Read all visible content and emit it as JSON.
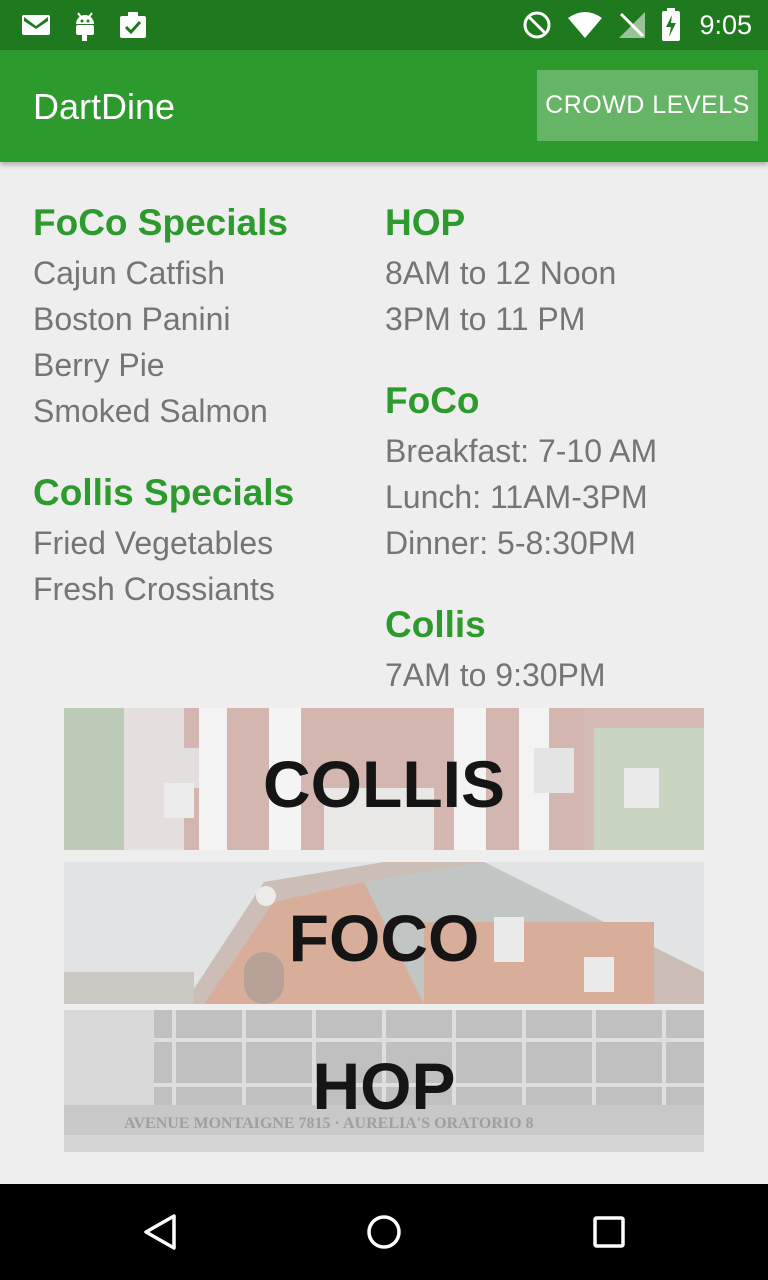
{
  "status_bar": {
    "time": "9:05",
    "left_icons": [
      "gmail-icon",
      "android-icon",
      "clipboard-check-icon"
    ],
    "right_icons": [
      "do-not-disturb-icon",
      "wifi-icon",
      "no-signal-icon",
      "battery-charging-icon"
    ]
  },
  "app_bar": {
    "title": "DartDine",
    "crowd_button": "CROWD LEVELS",
    "color": "#2c9a2c"
  },
  "specials": [
    {
      "title": "FoCo Specials",
      "items": [
        "Cajun Catfish",
        "Boston Panini",
        "Berry Pie",
        "Smoked Salmon"
      ]
    },
    {
      "title": "Collis Specials",
      "items": [
        "Fried Vegetables",
        "Fresh Crossiants"
      ]
    }
  ],
  "hours": [
    {
      "title": "HOP",
      "lines": [
        "8AM to 12 Noon",
        "3PM to 11 PM"
      ]
    },
    {
      "title": "FoCo",
      "lines": [
        "Breakfast: 7-10 AM",
        "Lunch: 11AM-3PM",
        "Dinner: 5-8:30PM"
      ]
    },
    {
      "title": "Collis",
      "lines": [
        "7AM to 9:30PM"
      ]
    }
  ],
  "banners": [
    {
      "label": "COLLIS"
    },
    {
      "label": "FOCO"
    },
    {
      "label": "HOP",
      "sign_text": "AVENUE MONTAIGNE 7815 · AURELIA'S ORATORIO 8"
    }
  ],
  "nav_bar": {
    "buttons": [
      "back-icon",
      "home-icon",
      "recents-icon"
    ]
  }
}
